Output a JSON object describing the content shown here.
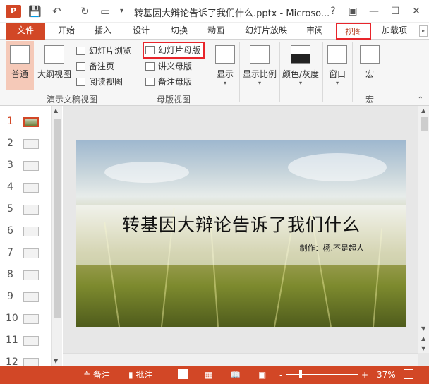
{
  "titlebar": {
    "app_icon": "P",
    "title": "转基因大辩论告诉了我们什么.pptx - Microso...",
    "help": "?",
    "ribbon_display": "▣",
    "minimize": "—",
    "maximize": "☐",
    "close": "✕",
    "quick_access": [
      "save-icon",
      "undo-icon",
      "redo-icon",
      "present-icon",
      "customize-icon"
    ]
  },
  "tabs": [
    {
      "label": "文件"
    },
    {
      "label": "开始"
    },
    {
      "label": "插入"
    },
    {
      "label": "设计"
    },
    {
      "label": "切换"
    },
    {
      "label": "动画"
    },
    {
      "label": "幻灯片放映"
    },
    {
      "label": "审阅"
    },
    {
      "label": "视图"
    },
    {
      "label": "加载项"
    }
  ],
  "ribbon": {
    "presentation_views": {
      "label": "演示文稿视图",
      "normal": "普通",
      "outline": "大纲视图",
      "slide_sorter": "幻灯片浏览",
      "notes_page": "备注页",
      "reading_view": "阅读视图"
    },
    "master_views": {
      "label": "母版视图",
      "slide_master": "幻灯片母版",
      "handout_master": "讲义母版",
      "notes_master": "备注母版"
    },
    "show": "显示",
    "zoom": "显示比例",
    "color": "颜色/灰度",
    "window": "窗口",
    "macros": "宏",
    "macros_group": "宏"
  },
  "thumbnails": [
    "1",
    "2",
    "3",
    "4",
    "5",
    "6",
    "7",
    "8",
    "9",
    "10",
    "11",
    "12"
  ],
  "slide": {
    "title": "转基因大辩论告诉了我们什么",
    "subtitle": "制作：杨.不是超人"
  },
  "statusbar": {
    "notes": "≙ 备注",
    "comments": "批注",
    "zoom_minus": "-",
    "zoom_plus": "+",
    "zoom_percent": "37%",
    "zoom_level": 0.37
  },
  "colors": {
    "accent": "#d24726",
    "highlight_border": "#e8252b"
  }
}
